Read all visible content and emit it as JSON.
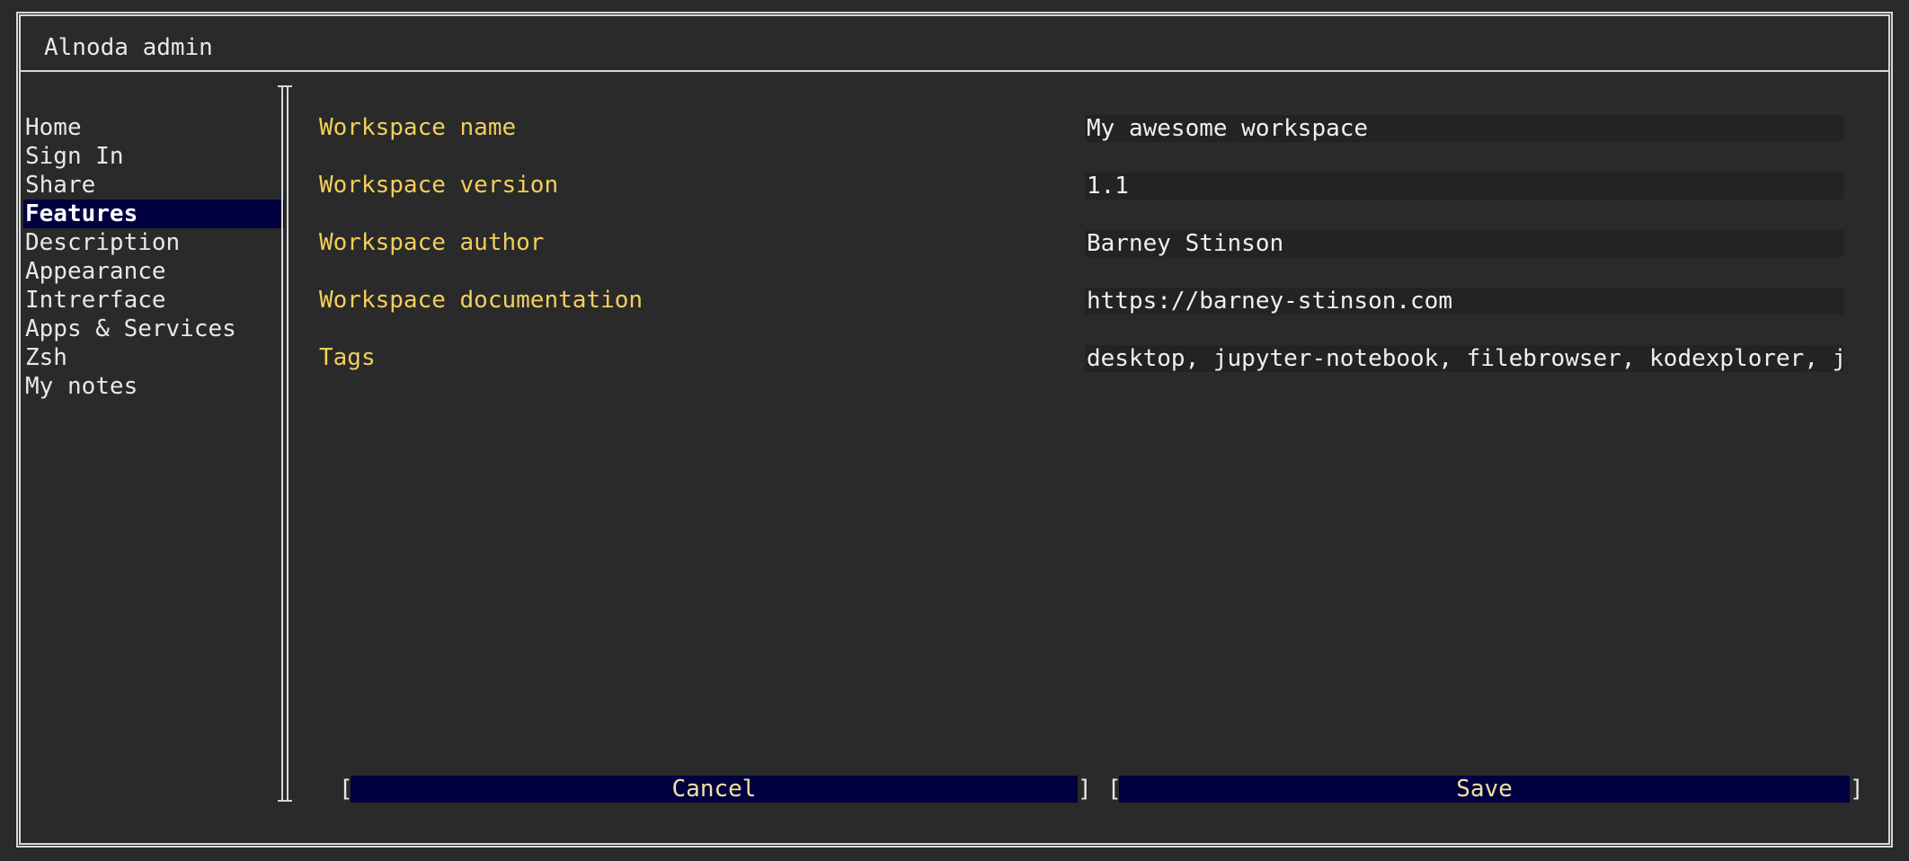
{
  "window": {
    "title": "Alnoda admin"
  },
  "sidebar": {
    "items": [
      {
        "label": "Home",
        "active": false
      },
      {
        "label": "Sign In",
        "active": false
      },
      {
        "label": "Share",
        "active": false
      },
      {
        "label": "Features",
        "active": true
      },
      {
        "label": "Description",
        "active": false
      },
      {
        "label": "Appearance",
        "active": false
      },
      {
        "label": "Intrerface",
        "active": false
      },
      {
        "label": "Apps & Services",
        "active": false
      },
      {
        "label": "Zsh",
        "active": false
      },
      {
        "label": "My notes",
        "active": false
      }
    ]
  },
  "form": {
    "fields": [
      {
        "label": "Workspace name",
        "value": "My awesome workspace"
      },
      {
        "label": "Workspace version",
        "value": "1.1"
      },
      {
        "label": "Workspace author",
        "value": "Barney Stinson"
      },
      {
        "label": "Workspace documentation",
        "value": "https://barney-stinson.com"
      },
      {
        "label": "Tags",
        "value": "desktop, jupyter-notebook, filebrowser, kodexplorer, jup"
      }
    ]
  },
  "buttons": {
    "cancel_label": "Cancel",
    "save_label": "Save",
    "bracket_open": "[",
    "bracket_close": "]"
  },
  "colors": {
    "background": "#2a2a2a",
    "label": "#f2cf5a",
    "highlight": "#000040",
    "field_background": "#232323"
  }
}
